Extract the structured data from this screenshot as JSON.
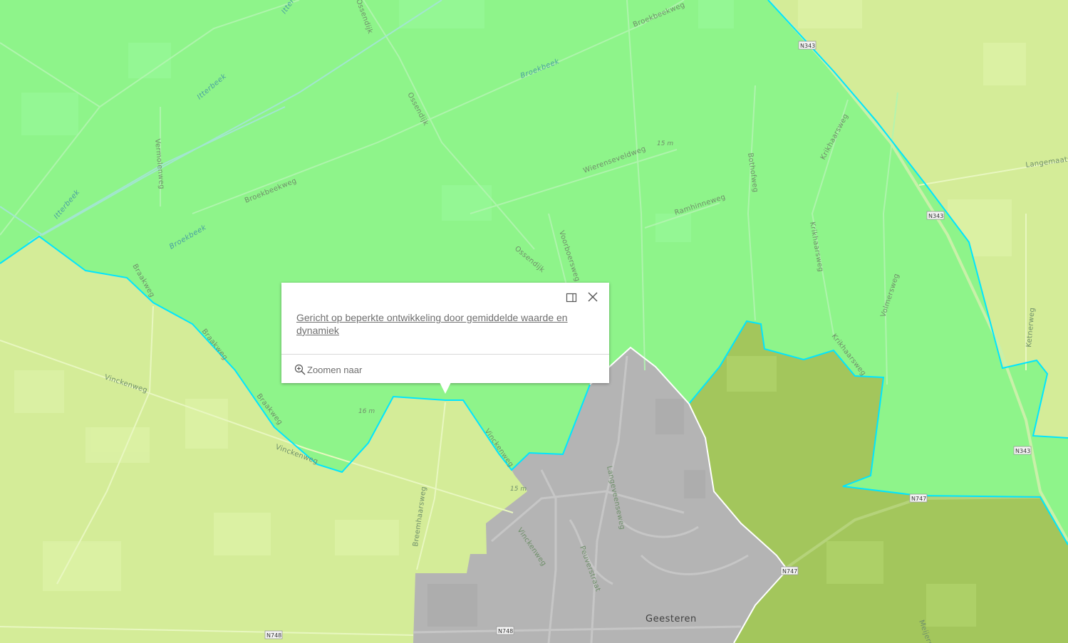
{
  "map": {
    "colors": {
      "light_zone": "#d4ec98",
      "green_zone": "#8ef48a",
      "olive_zone": "#a3c65c",
      "urban_zone": "#b4b4b4",
      "boundary": "#00e0ff"
    },
    "road_labels": {
      "broekbeekweg_top": "Broekbeekweg",
      "ossendijk_top": "Ossendijk",
      "itterbeek_top": "Itterbeek",
      "broekbeek_mid": "Broekbeek",
      "vermolenweg": "Vermolenweg",
      "broekbeekweg_mid": "Broekbeekweg",
      "itterbeek_left": "Itterbeek",
      "broekbeek_left": "Broekbeek",
      "ossendijk_mid": "Ossendijk",
      "wierenseveldweg": "Wierenseveldweg",
      "ramhinneweg": "Ramhinneweg",
      "voorboersweg": "Voorboersweg",
      "bothofweg": "Bothofweg",
      "krikhaarsweg_top": "Krikhaarsweg",
      "krikhaarsweg_mid": "Krikhaarsweg",
      "krikhaarsweg_low": "Krikhaarsweg",
      "volmersweg": "Volmersweg",
      "langemaatsweg": "Langemaats",
      "ketnerweg": "Ketnerweg",
      "braakweg_top": "Braakweg",
      "braakweg_mid": "Braakweg",
      "braakweg_low": "Braakweg",
      "vinckenweg_left": "Vinckenweg",
      "vinckenweg_mid": "Vinckenweg",
      "vinckenweg_town": "Vinckenweg",
      "breemhaarsweg": "Breemhaarsweg",
      "vinckenweg_short": "Vinckenweg",
      "langeveenseweg": "Langeveenseweg",
      "peuverstraat": "Peuverstraat",
      "meijersweg": "Meijers"
    },
    "elevations": {
      "e1": "15 m",
      "e2": "16 m",
      "e3": "15 m"
    },
    "shields": {
      "n343_a": "N343",
      "n343_b": "N343",
      "n343_c": "N343",
      "n747_a": "N747",
      "n747_b": "N747",
      "n748_a": "N748",
      "n748_b": "N748"
    },
    "town": "Geesteren"
  },
  "popup": {
    "title": "Gericht op beperkte ontwikkeling door gemiddelde waarde en dynamiek",
    "zoom_label": "Zoomen naar",
    "dock_icon": "dock-icon",
    "close_icon": "close-icon"
  }
}
